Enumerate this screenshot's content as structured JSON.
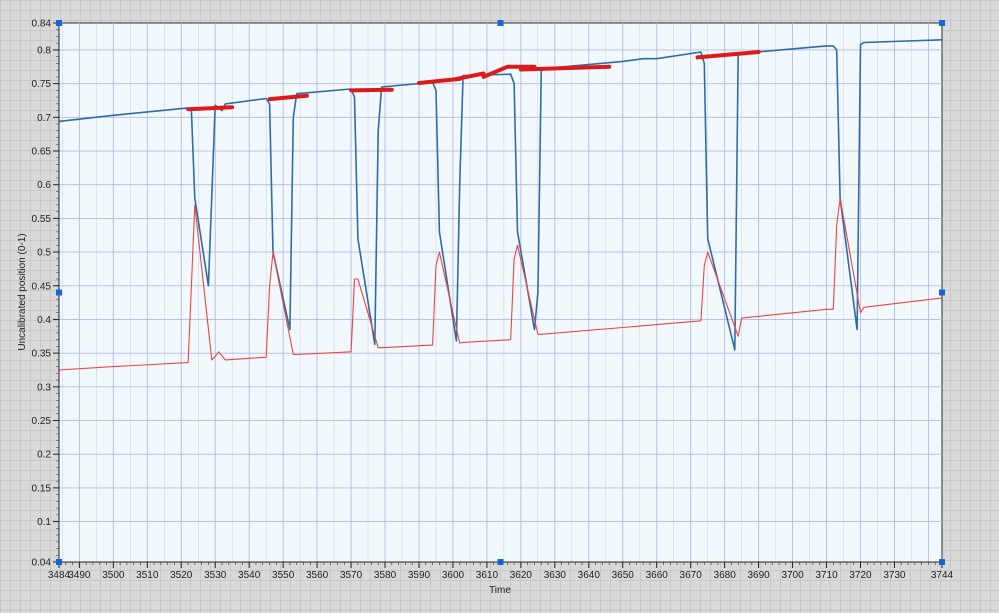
{
  "chart_data": {
    "type": "line",
    "xlabel": "Time",
    "ylabel": "Uncalibrated position (0-1)",
    "xlim": [
      3484,
      3744
    ],
    "ylim": [
      0.04,
      0.84
    ],
    "x_ticks": [
      3484,
      3490,
      3500,
      3510,
      3520,
      3530,
      3540,
      3550,
      3560,
      3570,
      3580,
      3590,
      3600,
      3610,
      3620,
      3630,
      3640,
      3650,
      3660,
      3670,
      3680,
      3690,
      3700,
      3710,
      3720,
      3730,
      3744
    ],
    "y_ticks": [
      0.04,
      0.1,
      0.15,
      0.2,
      0.25,
      0.3,
      0.35,
      0.4,
      0.45,
      0.5,
      0.55,
      0.6,
      0.65,
      0.7,
      0.75,
      0.8,
      0.84
    ],
    "grid": true,
    "colors": {
      "plot_bg": "#f2f9fc",
      "grid": "#b7b9e3",
      "series_blue": "#2e6da4",
      "series_red": "#ee4444",
      "annotation": "#dd1a1a",
      "handle": "#1565d8"
    },
    "series": [
      {
        "color": "#2e6da4",
        "x": [
          3484,
          3500,
          3522,
          3523,
          3524,
          3528,
          3530,
          3532,
          3533,
          3545,
          3546,
          3547,
          3552,
          3553,
          3554,
          3570,
          3571,
          3572,
          3577,
          3578,
          3579,
          3594,
          3595,
          3596,
          3601,
          3602,
          3603,
          3617,
          3618,
          3619,
          3624,
          3625,
          3626,
          3650,
          3656,
          3660,
          3673,
          3674,
          3675,
          3683,
          3684,
          3685,
          3710,
          3712,
          3713,
          3714,
          3719,
          3720,
          3721,
          3744
        ],
        "y": [
          0.694,
          0.703,
          0.714,
          0.71,
          0.58,
          0.45,
          0.718,
          0.71,
          0.72,
          0.728,
          0.72,
          0.5,
          0.385,
          0.7,
          0.735,
          0.742,
          0.73,
          0.52,
          0.363,
          0.68,
          0.745,
          0.752,
          0.74,
          0.53,
          0.368,
          0.6,
          0.762,
          0.764,
          0.75,
          0.53,
          0.385,
          0.44,
          0.772,
          0.783,
          0.787,
          0.787,
          0.797,
          0.78,
          0.52,
          0.355,
          0.795,
          0.795,
          0.806,
          0.806,
          0.8,
          0.58,
          0.385,
          0.808,
          0.811,
          0.815
        ]
      },
      {
        "color": "#ee4444",
        "x": [
          3484,
          3500,
          3522,
          3523,
          3524,
          3529,
          3530,
          3531,
          3533,
          3545,
          3546,
          3547,
          3553,
          3554,
          3570,
          3571,
          3572,
          3578,
          3579,
          3594,
          3595,
          3596,
          3602,
          3603,
          3617,
          3618,
          3619,
          3625,
          3626,
          3650,
          3673,
          3674,
          3675,
          3684,
          3685,
          3710,
          3712,
          3713,
          3714,
          3720,
          3721,
          3744
        ],
        "y": [
          0.325,
          0.33,
          0.336,
          0.45,
          0.57,
          0.34,
          0.345,
          0.352,
          0.34,
          0.344,
          0.45,
          0.5,
          0.348,
          0.348,
          0.352,
          0.46,
          0.46,
          0.358,
          0.358,
          0.362,
          0.48,
          0.5,
          0.365,
          0.366,
          0.37,
          0.49,
          0.51,
          0.378,
          0.378,
          0.388,
          0.398,
          0.48,
          0.5,
          0.375,
          0.402,
          0.415,
          0.415,
          0.54,
          0.58,
          0.41,
          0.418,
          0.432
        ]
      }
    ],
    "annotations": [
      {
        "color": "#dd1a1a",
        "x": [
          3522,
          3535
        ],
        "y": [
          0.712,
          0.715
        ]
      },
      {
        "color": "#dd1a1a",
        "x": [
          3546,
          3557
        ],
        "y": [
          0.727,
          0.732
        ]
      },
      {
        "color": "#dd1a1a",
        "x": [
          3570,
          3582
        ],
        "y": [
          0.74,
          0.741
        ]
      },
      {
        "color": "#dd1a1a",
        "x": [
          3590,
          3602
        ],
        "y": [
          0.751,
          0.757
        ]
      },
      {
        "color": "#dd1a1a",
        "x": [
          3601,
          3609
        ],
        "y": [
          0.757,
          0.765
        ]
      },
      {
        "color": "#dd1a1a",
        "x": [
          3609,
          3616,
          3624
        ],
        "y": [
          0.76,
          0.775,
          0.775
        ]
      },
      {
        "color": "#dd1a1a",
        "x": [
          3620,
          3646
        ],
        "y": [
          0.771,
          0.775
        ]
      },
      {
        "color": "#dd1a1a",
        "x": [
          3672,
          3690
        ],
        "y": [
          0.789,
          0.797
        ]
      }
    ]
  }
}
